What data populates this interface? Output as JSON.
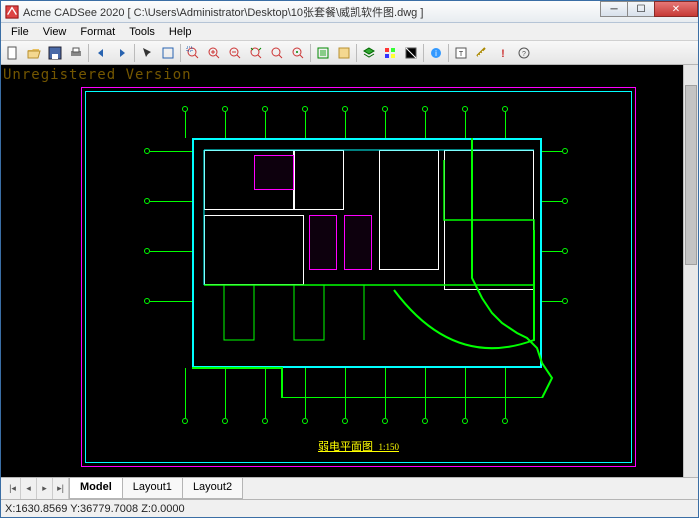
{
  "window": {
    "title": "Acme CADSee 2020 [ C:\\Users\\Administrator\\Desktop\\10张套餐\\威凯软件图.dwg ]"
  },
  "menu": {
    "items": [
      "File",
      "View",
      "Format",
      "Tools",
      "Help"
    ]
  },
  "toolbar": {
    "icons": [
      "new",
      "open",
      "save",
      "print",
      "sep",
      "arrow-left",
      "arrow-right",
      "sep",
      "cursor",
      "pan",
      "sep",
      "zoom-window",
      "zoom-in",
      "zoom-out",
      "zoom-extents",
      "zoom-realtime",
      "zoom-center",
      "sep",
      "plot-area",
      "regen",
      "sep",
      "layers",
      "color",
      "bg-toggle",
      "sep",
      "info",
      "sep",
      "text-find",
      "measure",
      "help",
      "about"
    ]
  },
  "watermark": "Unregistered Version",
  "drawing": {
    "title": "弱电平面图",
    "scale": "1:150"
  },
  "tabs": {
    "items": [
      "Model",
      "Layout1",
      "Layout2"
    ],
    "active": 0
  },
  "status": {
    "coords": "X:1630.8569 Y:36779.7008 Z:0.0000"
  }
}
